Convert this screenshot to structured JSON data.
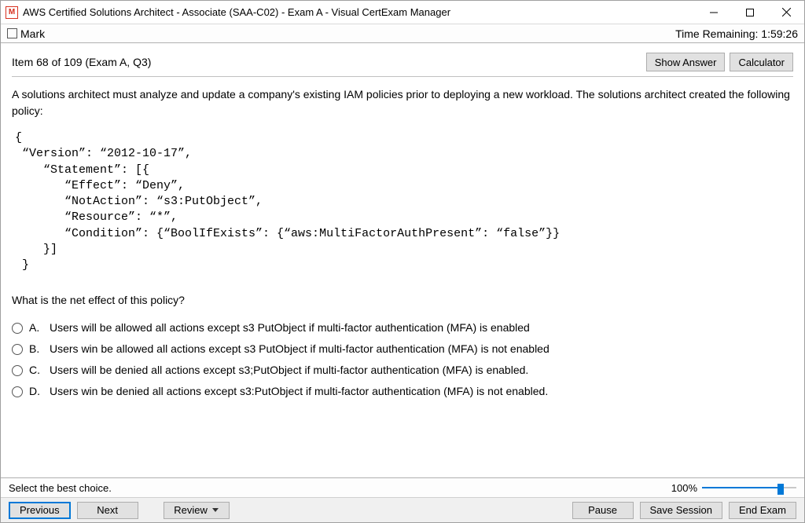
{
  "titlebar": {
    "app_icon_letter": "M",
    "title": "AWS Certified Solutions Architect - Associate (SAA-C02) - Exam A - Visual CertExam Manager"
  },
  "markbar": {
    "mark_label": "Mark",
    "time_label": "Time Remaining: 1:59:26"
  },
  "header": {
    "item_label": "Item 68 of 109  (Exam A, Q3)",
    "show_answer": "Show Answer",
    "calculator": "Calculator"
  },
  "question": {
    "intro": "A solutions architect must analyze and update a company's existing IAM policies prior to deploying a new workload. The solutions architect created the following policy:",
    "policy": "{\n “Version”: “2012-10-17”,\n    “Statement”: [{\n       “Effect”: “Deny”,\n       “NotAction”: “s3:PutObject”,\n       “Resource”: “*”,\n       “Condition”: {“BoolIfExists”: {“aws:MultiFactorAuthPresent”: “false”}}\n    }]\n }",
    "prompt": "What is the net effect of this policy?",
    "answers": [
      {
        "letter": "A.",
        "text": "Users will be allowed all actions except s3 PutObject if multi-factor authentication (MFA) is enabled"
      },
      {
        "letter": "B.",
        "text": "Users win be allowed all actions except s3 PutObject if multi-factor authentication (MFA) is not enabled"
      },
      {
        "letter": "C.",
        "text": "Users will be denied all actions except s3;PutObject if multi-factor authentication (MFA) is enabled."
      },
      {
        "letter": "D.",
        "text": "Users win be denied all actions except s3:PutObject if multi-factor authentication (MFA) is not enabled."
      }
    ]
  },
  "footer": {
    "instruction": "Select the best choice.",
    "progress_pct": "100%",
    "progress_value": 100,
    "previous": "Previous",
    "next": "Next",
    "review": "Review",
    "pause": "Pause",
    "save_session": "Save Session",
    "end_exam": "End Exam"
  }
}
